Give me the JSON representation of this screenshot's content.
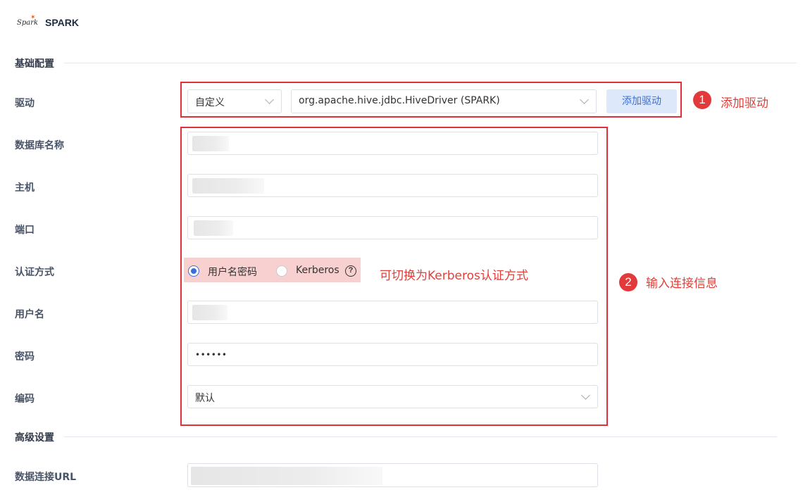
{
  "header": {
    "logo_text": "Spark",
    "title": "SPARK"
  },
  "sections": {
    "basic": "基础配置",
    "advanced": "高级设置"
  },
  "labels": {
    "driver": "驱动",
    "db_name": "数据库名称",
    "host": "主机",
    "port": "端口",
    "auth_method": "认证方式",
    "username": "用户名",
    "password": "密码",
    "encoding": "编码",
    "url": "数据连接URL"
  },
  "driver": {
    "mode_value": "自定义",
    "driver_value": "org.apache.hive.jdbc.HiveDriver (SPARK)",
    "add_button": "添加驱动"
  },
  "auth": {
    "options": [
      "用户名密码",
      "Kerberos"
    ],
    "selected": "用户名密码",
    "help_icon": "question-circle-icon"
  },
  "password_value": "••••••",
  "encoding_value": "默认",
  "annotations": {
    "step1_number": "1",
    "step1_text": "添加驱动",
    "step2_number": "2",
    "step2_text": "输入连接信息",
    "kerberos_note": "可切换为Kerberos认证方式"
  },
  "colors": {
    "accent": "#3a6fd8",
    "annotation_red": "#e0303a",
    "button_bg": "#dde8fb"
  }
}
